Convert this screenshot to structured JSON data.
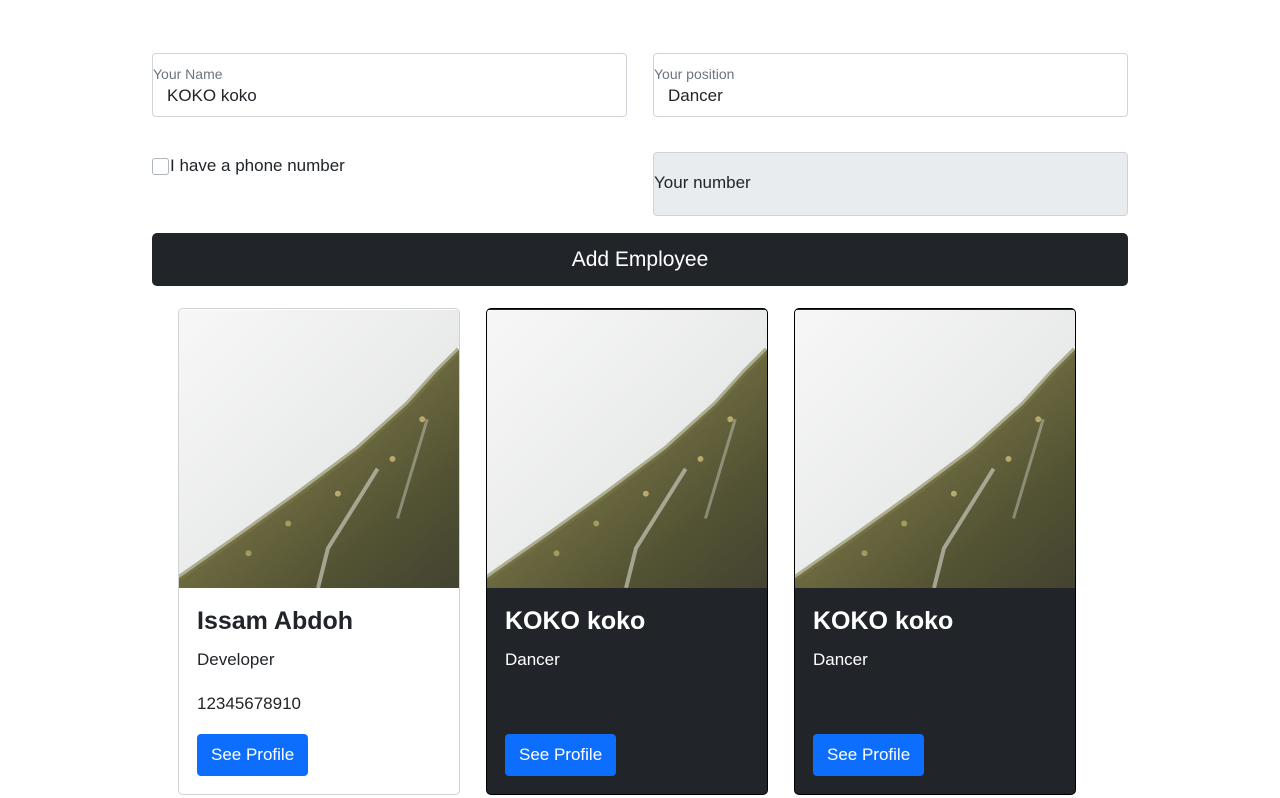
{
  "form": {
    "name_label": "Your Name",
    "name_value": "KOKO koko",
    "position_label": "Your position",
    "position_value": "Dancer",
    "phone_checkbox_label": "I have a phone number",
    "phone_checked": false,
    "number_placeholder": "Your number",
    "add_button_label": "Add Employee"
  },
  "employees": [
    {
      "name": "Issam Abdoh",
      "position": "Developer",
      "number": "12345678910",
      "button_label": "See Profile",
      "theme": "light"
    },
    {
      "name": "KOKO koko",
      "position": "Dancer",
      "number": "",
      "button_label": "See Profile",
      "theme": "dark"
    },
    {
      "name": "KOKO koko",
      "position": "Dancer",
      "number": "",
      "button_label": "See Profile",
      "theme": "dark"
    }
  ],
  "colors": {
    "button_dark": "#212529",
    "button_primary": "#0d6efd",
    "field_disabled": "#e9ecef"
  },
  "icons": {
    "card_image": "foggy-mountain-forest-image"
  }
}
